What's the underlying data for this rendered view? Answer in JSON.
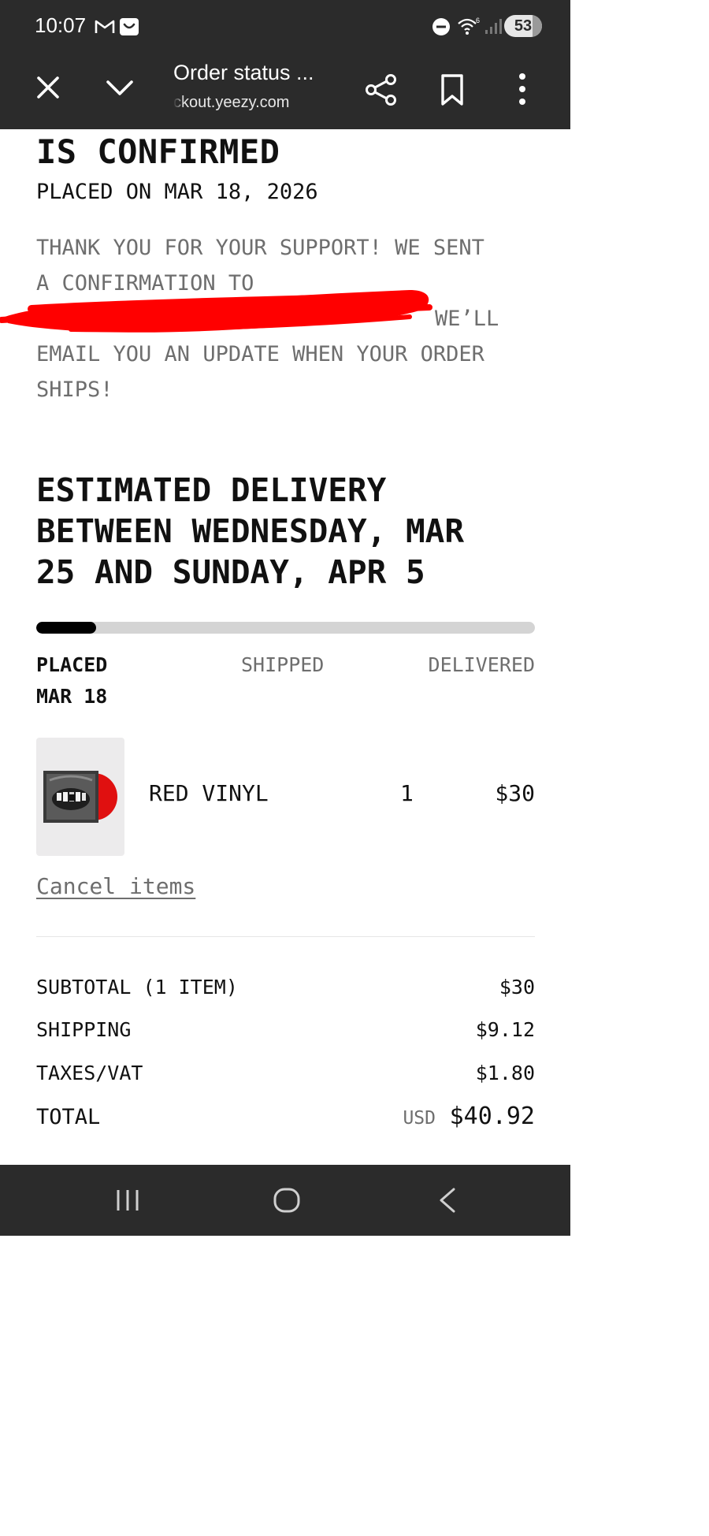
{
  "status_bar": {
    "time": "10:07",
    "battery": "53",
    "icons": [
      "gmail-icon",
      "shopping-bag-icon",
      "do-not-disturb-icon",
      "wifi-icon",
      "signal-icon",
      "battery-icon"
    ]
  },
  "toolbar": {
    "title": "Order status ...",
    "url": "ckout.yeezy.com",
    "icons": [
      "close-icon",
      "chevron-down-icon",
      "share-icon",
      "bookmark-icon",
      "more-vert-icon"
    ]
  },
  "order": {
    "heading": "IS CONFIRMED",
    "placed_on": "PLACED ON MAR 18, 2026",
    "thanks_line1": "THANK YOU FOR YOUR SUPPORT! WE SENT",
    "thanks_line2": "A CONFIRMATION TO",
    "thanks_line3": "WE’LL",
    "thanks_line4": "EMAIL YOU AN UPDATE WHEN YOUR ORDER",
    "thanks_line5": "SHIPS!",
    "redaction_color": "#ff0000"
  },
  "delivery": {
    "line1": "ESTIMATED DELIVERY",
    "line2": "BETWEEN WEDNESDAY, MAR",
    "line3": "25 AND SUNDAY, APR 5",
    "progress": 0.12,
    "steps": {
      "placed": "PLACED",
      "placed_date": "MAR 18",
      "shipped": "SHIPPED",
      "delivered": "DELIVERED"
    }
  },
  "items": [
    {
      "name": "RED VINYL",
      "quantity": "1",
      "price": "$30",
      "thumbnail": "red-vinyl-album-cover"
    }
  ],
  "cancel_link": "Cancel items",
  "summary": {
    "subtotal_label": "SUBTOTAL (1 ITEM)",
    "subtotal_value": "$30",
    "shipping_label": "SHIPPING",
    "shipping_value": "$9.12",
    "taxes_label": "TAXES/VAT",
    "taxes_value": "$1.80",
    "total_label": "TOTAL",
    "total_currency": "USD",
    "total_value": "$40.92"
  },
  "nav_bar": {
    "icons": [
      "recents-icon",
      "home-icon",
      "back-icon"
    ]
  },
  "colors": {
    "chrome": "#2b2b2b",
    "text": "#111111",
    "muted": "#6e6e6e",
    "progress_track": "#d4d4d4",
    "progress_fill": "#000000",
    "vinyl_red": "#e01010"
  }
}
